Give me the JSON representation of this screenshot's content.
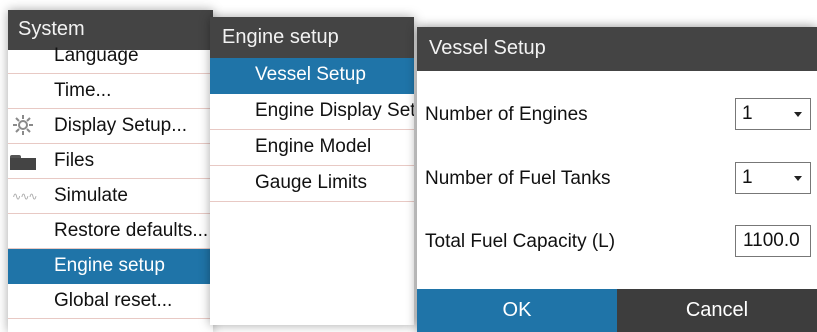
{
  "system_menu": {
    "title": "System",
    "items": [
      {
        "label": "Language",
        "icon": ""
      },
      {
        "label": "Time...",
        "icon": ""
      },
      {
        "label": "Display Setup...",
        "icon": "gear-icon"
      },
      {
        "label": "Files",
        "icon": "folder-icon"
      },
      {
        "label": "Simulate",
        "icon": "simulate-icon"
      },
      {
        "label": "Restore defaults...",
        "icon": ""
      },
      {
        "label": "Engine setup",
        "icon": "",
        "selected": true
      },
      {
        "label": "Global reset...",
        "icon": ""
      }
    ]
  },
  "engine_menu": {
    "title": "Engine setup",
    "items": [
      {
        "label": "Vessel Setup",
        "selected": true
      },
      {
        "label": "Engine Display Setup"
      },
      {
        "label": "Engine Model"
      },
      {
        "label": "Gauge Limits"
      }
    ]
  },
  "vessel_dialog": {
    "title": "Vessel Setup",
    "fields": [
      {
        "label": "Number of Engines",
        "value": "1",
        "type": "dropdown"
      },
      {
        "label": "Number of Fuel Tanks",
        "value": "1",
        "type": "dropdown"
      },
      {
        "label": "Total Fuel Capacity (L)",
        "value": "1100.0",
        "type": "text"
      }
    ],
    "ok_label": "OK",
    "cancel_label": "Cancel"
  },
  "colors": {
    "header": "#444444",
    "accent": "#1f74a8",
    "divider": "#e8c9c4"
  }
}
